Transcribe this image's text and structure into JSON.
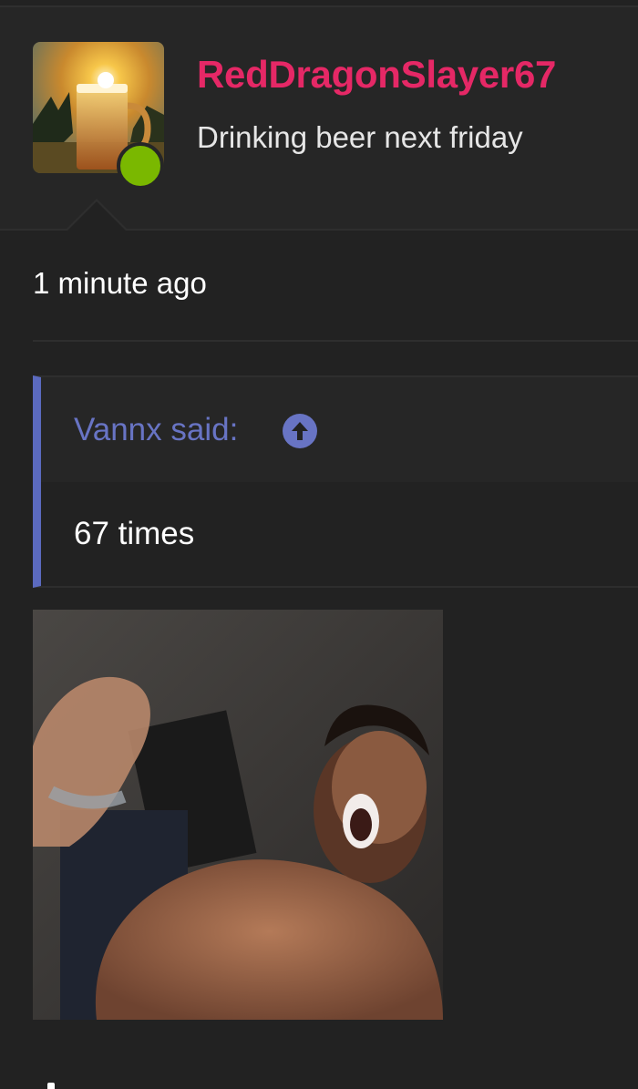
{
  "post": {
    "username": "RedDragonSlayer67",
    "status": "Drinking beer next friday",
    "online": true,
    "timestamp": "1 minute ago"
  },
  "quote": {
    "author": "Vannx said:",
    "body": "67 times",
    "jump_icon": "arrow-up-circle-icon"
  },
  "colors": {
    "background": "#222222",
    "username": "#e52866",
    "quote_accent": "#5b6abf",
    "online_dot": "#7ab800"
  }
}
